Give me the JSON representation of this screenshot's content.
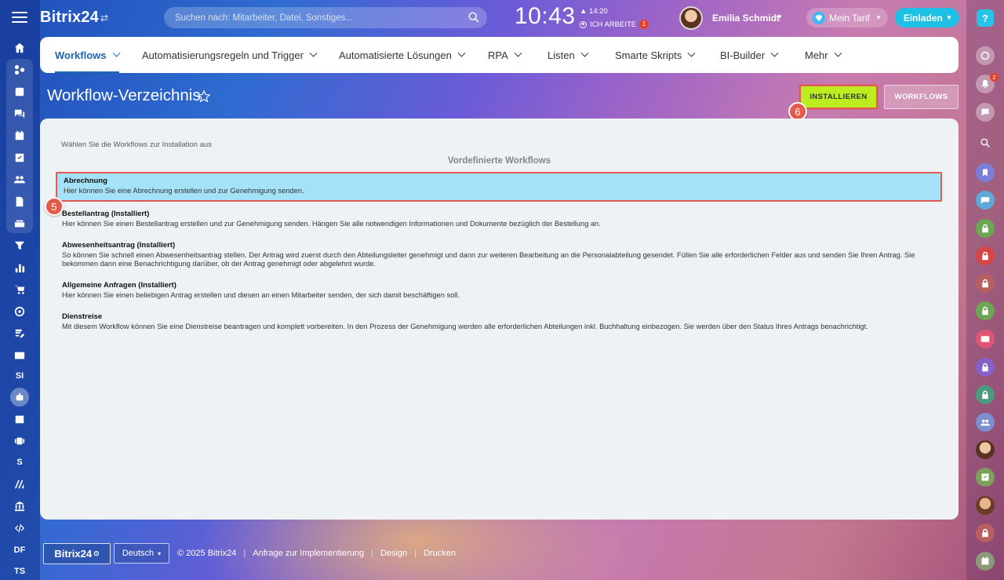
{
  "header": {
    "logo": "Bitrix24",
    "search_placeholder": "Suchen nach: Mitarbeiter, Datei, Sonstiges...",
    "clock": "10:43",
    "clock_extra": "14:20",
    "work_status": "ICH ARBEITE",
    "work_badge": "1",
    "user_name": "Emilia Schmidt",
    "tariff": "Mein Tarif",
    "invite": "Einladen"
  },
  "nav": {
    "items": [
      {
        "label": "Workflows"
      },
      {
        "label": "Automatisierungsregeln und Trigger"
      },
      {
        "label": "Automatisierte Lösungen"
      },
      {
        "label": "RPA"
      },
      {
        "label": "Listen"
      },
      {
        "label": "Smarte Skripts"
      },
      {
        "label": "BI-Builder"
      },
      {
        "label": "Mehr"
      }
    ]
  },
  "page": {
    "title": "Workflow-Verzeichnis",
    "install_button": "INSTALLIEREN",
    "workflows_button": "WORKFLOWS",
    "step5": "5",
    "step6": "6"
  },
  "content": {
    "hint": "Wählen Sie die Workflows zur Installation aus",
    "section_title": "Vordefinierte Workflows",
    "workflows": [
      {
        "title": "Abrechnung",
        "desc": "Hier können Sie eine Abrechnung erstellen und zur Genehmigung senden.",
        "selected": true
      },
      {
        "title": "Bestellantrag (Installiert)",
        "desc": "Hier können Sie einen Bestellantrag erstellen und zur Genehmigung senden. Hängen Sie alle notwendigen Informationen und Dokumente bezüglich der Bestellung an."
      },
      {
        "title": "Abwesenheitsantrag (Installiert)",
        "desc": "So können Sie schnell einen Abwesenheitsantrag stellen. Der Antrag wird zuerst durch den Abteilungsleiter genehmigt und dann zur weiteren Bearbeitung an die Personalabteilung gesendet. Füllen Sie alle erforderlichen Felder aus und senden Sie Ihren Antrag. Sie bekommen dann eine Benachrichtigung darüber, ob der Antrag genehmigt oder abgelehnt wurde."
      },
      {
        "title": "Allgemeine Anfragen (Installiert)",
        "desc": "Hier können Sie einen beliebigen Antrag erstellen und diesen an einen Mitarbeiter senden, der sich damit beschäftigen soll."
      },
      {
        "title": "Dienstreise",
        "desc": "Mit diesem Workflow können Sie eine Dienstreise beantragen und komplett vorbereiten. In den Prozess der Genehmigung werden alle erforderlichen Abteilungen inkl. Buchhaltung einbezogen. Sie werden über den Status Ihres Antrags benachrichtigt."
      }
    ]
  },
  "left_sidebar": {
    "labels": [
      "SI",
      "S",
      "DF",
      "TS"
    ]
  },
  "right_sidebar": {
    "notif_badge": "2"
  },
  "footer": {
    "logo": "Bitrix24",
    "language": "Deutsch",
    "copyright": "© 2025 Bitrix24",
    "links": [
      "Anfrage zur Implementierung",
      "Design",
      "Drucken"
    ]
  },
  "colors": {
    "accent": "#2067b0",
    "install_button": "#bbed21",
    "selected_row": "#a5e2f7",
    "highlight_border": "#e25a52",
    "invite_button": "#1ec1e5"
  }
}
